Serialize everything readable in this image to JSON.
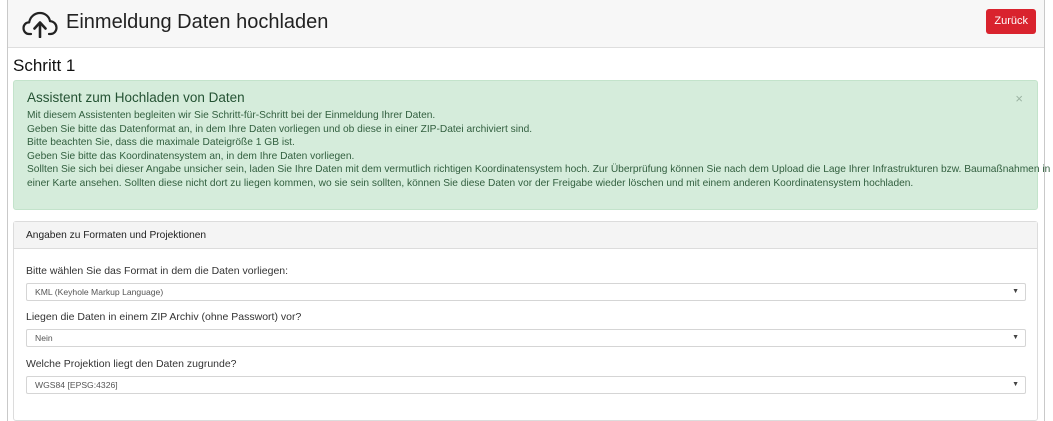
{
  "header": {
    "title": "Einmeldung Daten hochladen",
    "back_label": "Zurück",
    "back_color": "#d9232e",
    "icon": "cloud-upload-icon"
  },
  "step": {
    "title": "Schritt 1"
  },
  "alert": {
    "heading": "Assistent zum Hochladen von Daten",
    "close": "×",
    "lines": [
      "Mit diesem Assistenten begleiten wir Sie Schritt-für-Schritt bei der Einmeldung Ihrer Daten.",
      "Geben Sie bitte das Datenformat an, in dem Ihre Daten vorliegen und ob diese in einer ZIP-Datei archiviert sind.",
      "Bitte beachten Sie, dass die maximale Dateigröße 1 GB ist.",
      "Geben Sie bitte das Koordinatensystem an, in dem Ihre Daten vorliegen.",
      "Sollten Sie sich bei dieser Angabe unsicher sein, laden Sie Ihre Daten mit dem vermutlich richtigen Koordinatensystem hoch. Zur Überprüfung können Sie nach dem Upload die Lage Ihrer Infrastrukturen bzw. Baumaßnahmen in",
      "einer Karte ansehen. Sollten diese nicht dort zu liegen kommen, wo sie sein sollten, können Sie diese Daten vor der Freigabe wieder löschen und mit einem anderen Koordinatensystem hochladen."
    ],
    "bg_color": "#d5ecdb"
  },
  "card": {
    "header": "Angaben zu Formaten und Projektionen",
    "fields": [
      {
        "label": "Bitte wählen Sie das Format in dem die Daten vorliegen:",
        "value": "KML (Keyhole Markup Language)"
      },
      {
        "label": "Liegen die Daten in einem ZIP Archiv (ohne Passwort) vor?",
        "value": "Nein"
      },
      {
        "label": "Welche Projektion liegt den Daten zugrunde?",
        "value": "WGS84 [EPSG:4326]"
      }
    ],
    "caret": "▼"
  }
}
